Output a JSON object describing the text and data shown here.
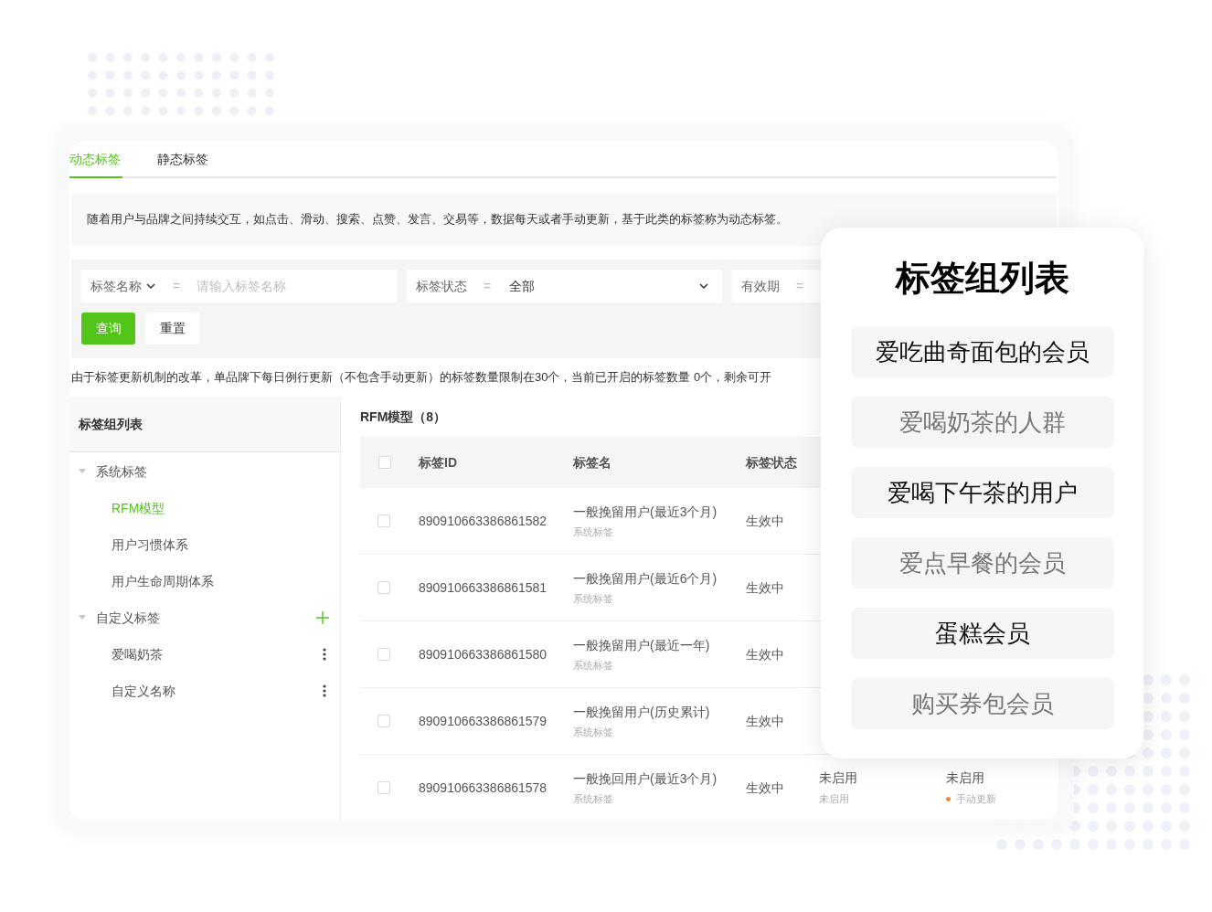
{
  "tabs": [
    {
      "label": "动态标签",
      "selected": true
    },
    {
      "label": "静态标签",
      "selected": false
    }
  ],
  "description": "随着用户与品牌之间持续交互，如点击、滑动、搜索、点赞、发言、交易等，数据每天或者手动更新，基于此类的标签称为动态标签。",
  "filters": [
    {
      "kind": "text",
      "label": "标签名称",
      "label_dropdown": true,
      "operator": "=",
      "placeholder": "请输入标签名称"
    },
    {
      "kind": "select",
      "label": "标签状态",
      "operator": "=",
      "value": "全部"
    },
    {
      "kind": "partial",
      "label": "有效期",
      "operator": "="
    }
  ],
  "buttons": [
    {
      "label": "查询",
      "primary": true
    },
    {
      "label": "重置",
      "primary": false
    }
  ],
  "notice": "由于标签更新机制的改革，单品牌下每日例行更新（不包含手动更新）的标签数量限制在30个，当前已开启的标签数量 0个，剩余可开",
  "sidebar": {
    "title": "标签组列表",
    "groups": [
      {
        "label": "系统标签",
        "expanded": true,
        "addable": false,
        "children": [
          {
            "label": "RFM模型",
            "selected": true,
            "menu": false
          },
          {
            "label": "用户习惯体系",
            "selected": false,
            "menu": false
          },
          {
            "label": "用户生命周期体系",
            "selected": false,
            "menu": false
          }
        ]
      },
      {
        "label": "自定义标签",
        "expanded": true,
        "addable": true,
        "children": [
          {
            "label": "爱喝奶茶",
            "selected": false,
            "menu": true
          },
          {
            "label": "自定义名称",
            "selected": false,
            "menu": true
          }
        ]
      }
    ]
  },
  "table": {
    "title": "RFM模型（8）",
    "columns": [
      "标签ID",
      "标签名",
      "标签状态"
    ],
    "header_checked": false,
    "rows": [
      {
        "checked": false,
        "id": "890910663386861582",
        "name": "一般挽留用户(最近3个月)",
        "source": "系统标签",
        "status": "生效中"
      },
      {
        "checked": false,
        "id": "890910663386861581",
        "name": "一般挽留用户(最近6个月)",
        "source": "系统标签",
        "status": "生效中"
      },
      {
        "checked": false,
        "id": "890910663386861580",
        "name": "一般挽留用户(最近一年)",
        "source": "系统标签",
        "status": "生效中"
      },
      {
        "checked": false,
        "id": "890910663386861579",
        "name": "一般挽留用户(历史累计)",
        "source": "系统标签",
        "status": "生效中"
      },
      {
        "checked": false,
        "id": "890910663386861578",
        "name": "一般挽回用户(最近3个月)",
        "source": "系统标签",
        "status": "生效中",
        "column_4": {
          "text": "未启用",
          "note": "未启用"
        },
        "column_5": {
          "text": "未启用",
          "note": "手动更新",
          "color": "#f5873c"
        }
      }
    ]
  },
  "popup": {
    "title": "标签组列表",
    "items": [
      {
        "label": "爱吃曲奇面包的会员",
        "muted": false
      },
      {
        "label": "爱喝奶茶的人群",
        "muted": true
      },
      {
        "label": "爱喝下午茶的用户",
        "muted": false
      },
      {
        "label": "爱点早餐的会员",
        "muted": true
      },
      {
        "label": "蛋糕会员",
        "muted": false
      },
      {
        "label": "购买券包会员",
        "muted": true
      }
    ]
  }
}
